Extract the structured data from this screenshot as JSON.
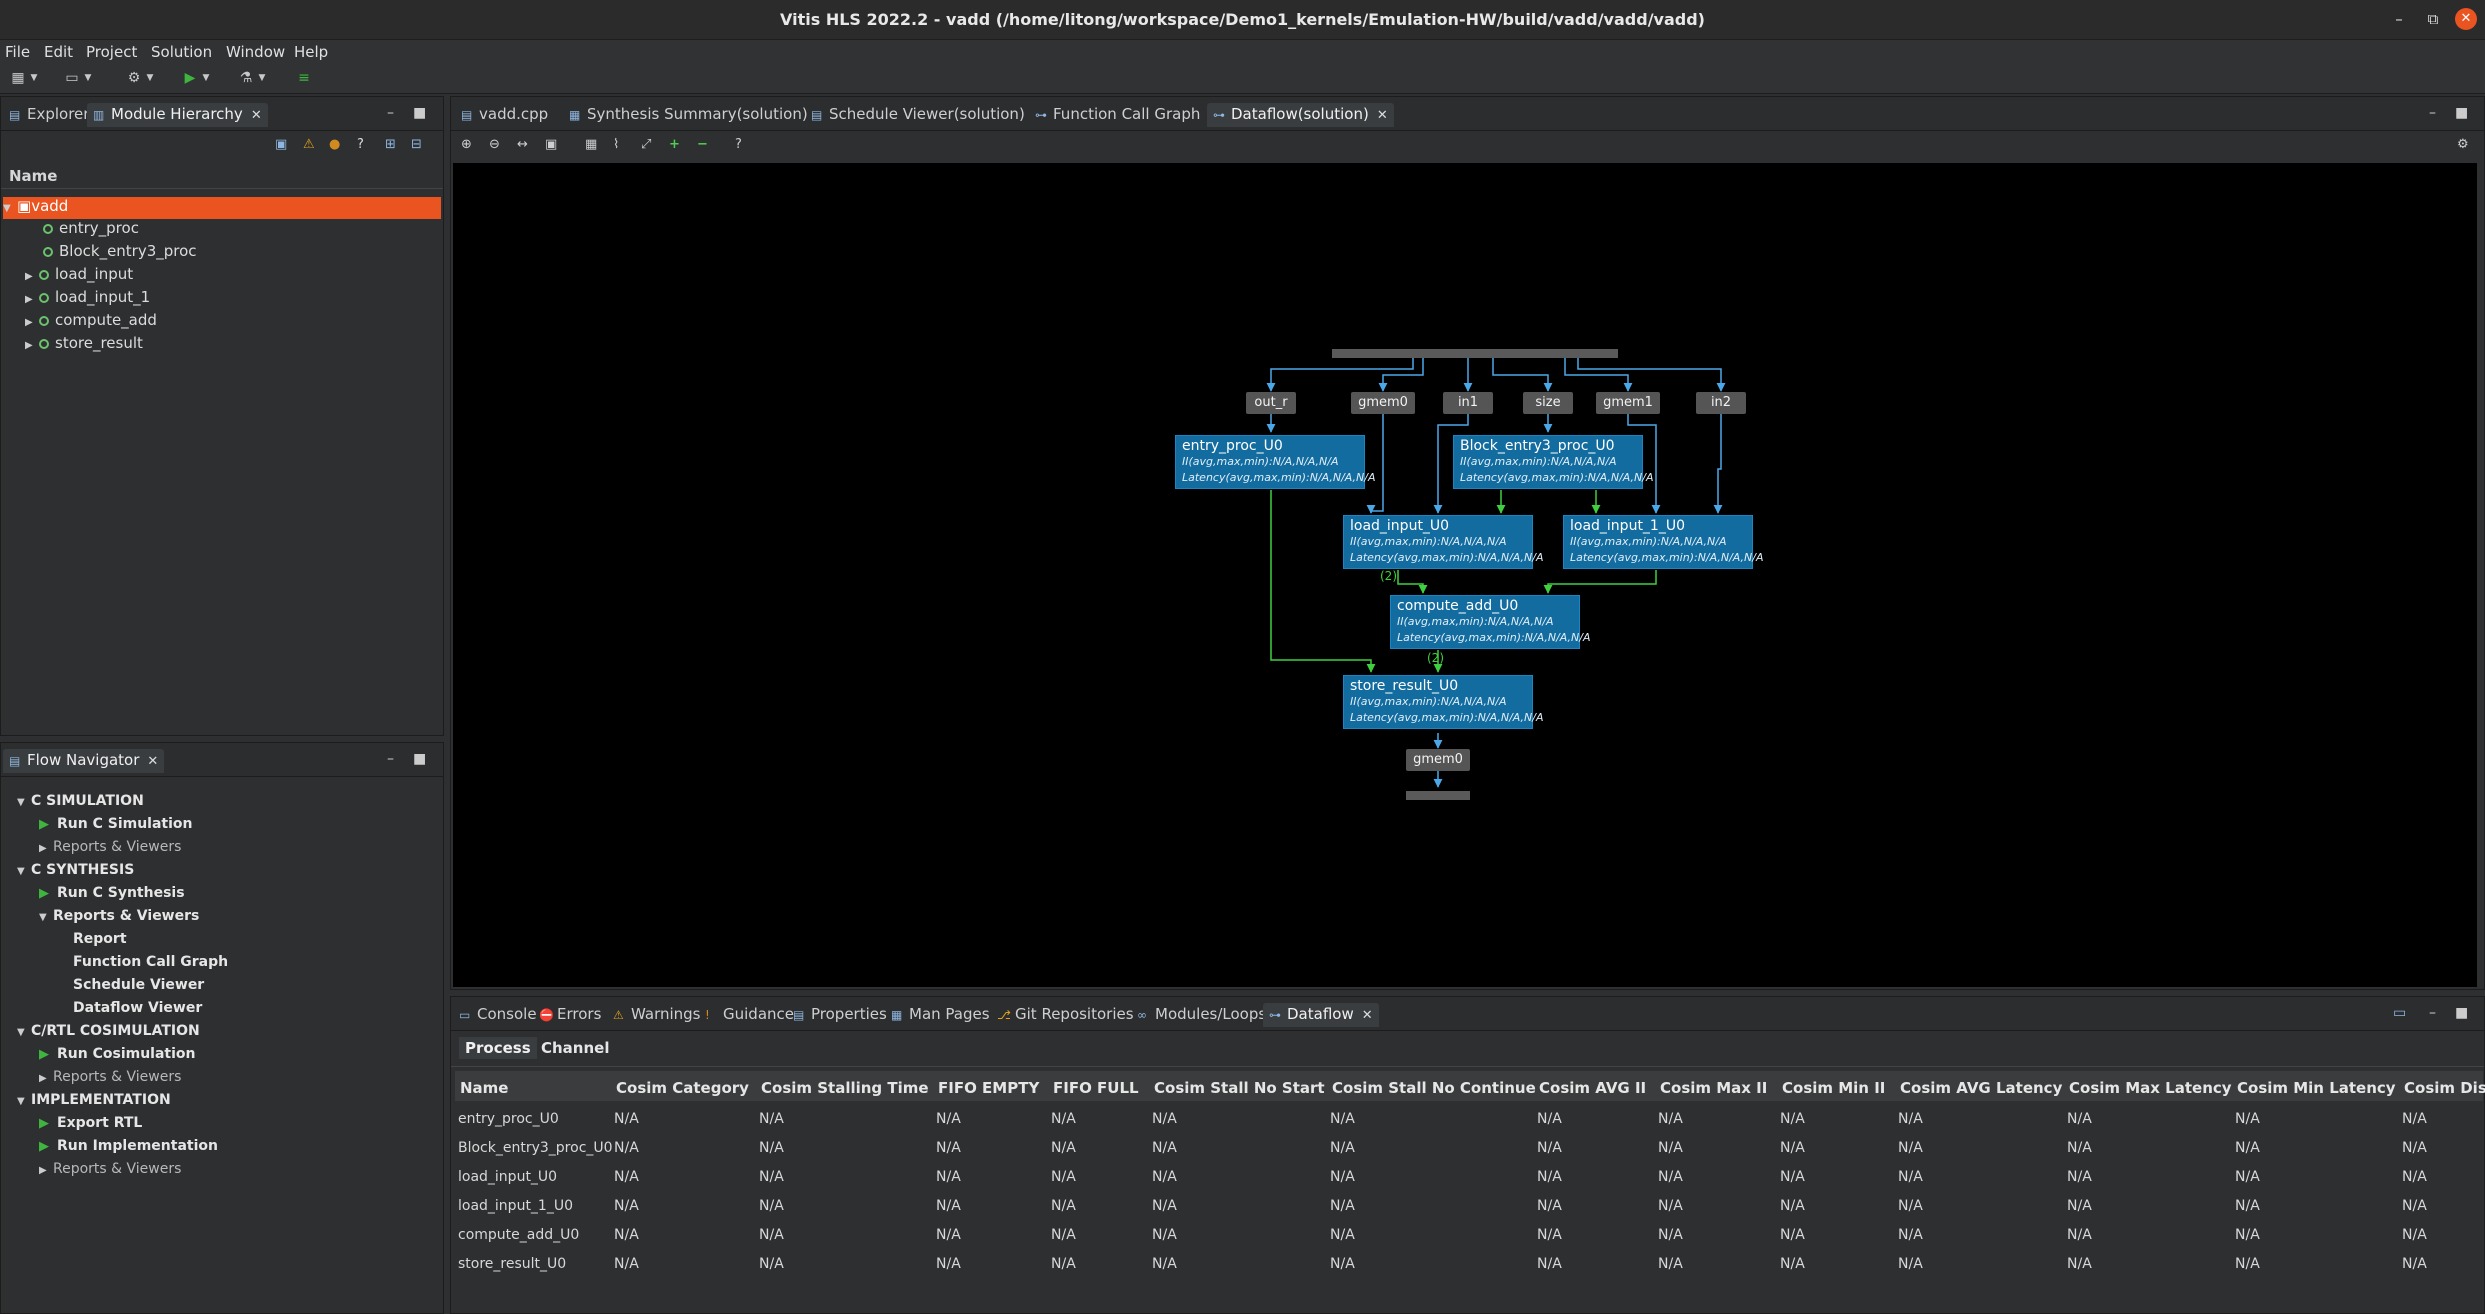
{
  "window": {
    "title": "Vitis HLS 2022.2 - vadd (/home/litong/workspace/Demo1_kernels/Emulation-HW/build/vadd/vadd/vadd)",
    "min": "–",
    "max": "⧉",
    "close": "✕"
  },
  "menu": [
    "File",
    "Edit",
    "Project",
    "Solution",
    "Window",
    "Help"
  ],
  "left_top": {
    "tabs": [
      {
        "label": "Explorer"
      },
      {
        "label": "Module Hierarchy",
        "close": "✕"
      }
    ],
    "column": "Name",
    "tree": [
      {
        "label": "vadd",
        "expanded": true,
        "selected": true
      },
      {
        "label": "entry_proc"
      },
      {
        "label": "Block_entry3_proc"
      },
      {
        "label": "load_input",
        "expandable": true
      },
      {
        "label": "load_input_1",
        "expandable": true
      },
      {
        "label": "compute_add",
        "expandable": true
      },
      {
        "label": "store_result",
        "expandable": true
      }
    ]
  },
  "flow_nav": {
    "tab": "Flow Navigator",
    "close": "✕",
    "sections": [
      {
        "title": "C SIMULATION",
        "run": "Run C Simulation",
        "reports": "Reports & Viewers"
      },
      {
        "title": "C SYNTHESIS",
        "run": "Run C Synthesis",
        "reports": "Reports & Viewers",
        "subitems": [
          "Report",
          "Function Call Graph",
          "Schedule Viewer",
          "Dataflow Viewer"
        ]
      },
      {
        "title": "C/RTL COSIMULATION",
        "run": "Run Cosimulation",
        "reports": "Reports & Viewers"
      },
      {
        "title": "IMPLEMENTATION",
        "run": "Export RTL",
        "run2": "Run Implementation",
        "reports": "Reports & Viewers"
      }
    ]
  },
  "editor": {
    "tabs": [
      {
        "label": "vadd.cpp"
      },
      {
        "label": "Synthesis Summary(solution)"
      },
      {
        "label": "Schedule Viewer(solution)"
      },
      {
        "label": "Function Call Graph"
      },
      {
        "label": "Dataflow(solution)",
        "active": true,
        "close": "✕"
      }
    ]
  },
  "dataflow": {
    "ports_top": [
      "out_r",
      "gmem0",
      "in1",
      "size",
      "gmem1",
      "in2"
    ],
    "port_bottom": "gmem0",
    "channel_label": "(2)",
    "nodes": [
      {
        "name": "entry_proc_U0",
        "ii": "II(avg,max,min):N/A,N/A,N/A",
        "lat": "Latency(avg,max,min):N/A,N/A,N/A"
      },
      {
        "name": "Block_entry3_proc_U0",
        "ii": "II(avg,max,min):N/A,N/A,N/A",
        "lat": "Latency(avg,max,min):N/A,N/A,N/A"
      },
      {
        "name": "load_input_U0",
        "ii": "II(avg,max,min):N/A,N/A,N/A",
        "lat": "Latency(avg,max,min):N/A,N/A,N/A"
      },
      {
        "name": "load_input_1_U0",
        "ii": "II(avg,max,min):N/A,N/A,N/A",
        "lat": "Latency(avg,max,min):N/A,N/A,N/A"
      },
      {
        "name": "compute_add_U0",
        "ii": "II(avg,max,min):N/A,N/A,N/A",
        "lat": "Latency(avg,max,min):N/A,N/A,N/A"
      },
      {
        "name": "store_result_U0",
        "ii": "II(avg,max,min):N/A,N/A,N/A",
        "lat": "Latency(avg,max,min):N/A,N/A,N/A"
      }
    ]
  },
  "bottom": {
    "tabs": [
      {
        "label": "Console"
      },
      {
        "label": "Errors"
      },
      {
        "label": "Warnings"
      },
      {
        "label": "Guidance"
      },
      {
        "label": "Properties"
      },
      {
        "label": "Man Pages"
      },
      {
        "label": "Git Repositories"
      },
      {
        "label": "Modules/Loops"
      },
      {
        "label": "Dataflow",
        "active": true,
        "close": "✕"
      }
    ],
    "subtabs": [
      "Process",
      "Channel"
    ],
    "columns": [
      "Name",
      "Cosim Category",
      "Cosim Stalling Time",
      "FIFO EMPTY",
      "FIFO FULL",
      "Cosim Stall No Start",
      "Cosim Stall No Continue",
      "Cosim AVG II",
      "Cosim Max II",
      "Cosim Min II",
      "Cosim AVG Latency",
      "Cosim Max Latency",
      "Cosim Min Latency",
      "Cosim Dis"
    ],
    "rows": [
      [
        "entry_proc_U0",
        "N/A",
        "N/A",
        "N/A",
        "N/A",
        "N/A",
        "N/A",
        "N/A",
        "N/A",
        "N/A",
        "N/A",
        "N/A",
        "N/A",
        "N/A"
      ],
      [
        "Block_entry3_proc_U0",
        "N/A",
        "N/A",
        "N/A",
        "N/A",
        "N/A",
        "N/A",
        "N/A",
        "N/A",
        "N/A",
        "N/A",
        "N/A",
        "N/A",
        "N/A"
      ],
      [
        "load_input_U0",
        "N/A",
        "N/A",
        "N/A",
        "N/A",
        "N/A",
        "N/A",
        "N/A",
        "N/A",
        "N/A",
        "N/A",
        "N/A",
        "N/A",
        "N/A"
      ],
      [
        "load_input_1_U0",
        "N/A",
        "N/A",
        "N/A",
        "N/A",
        "N/A",
        "N/A",
        "N/A",
        "N/A",
        "N/A",
        "N/A",
        "N/A",
        "N/A",
        "N/A"
      ],
      [
        "compute_add_U0",
        "N/A",
        "N/A",
        "N/A",
        "N/A",
        "N/A",
        "N/A",
        "N/A",
        "N/A",
        "N/A",
        "N/A",
        "N/A",
        "N/A",
        "N/A"
      ],
      [
        "store_result_U0",
        "N/A",
        "N/A",
        "N/A",
        "N/A",
        "N/A",
        "N/A",
        "N/A",
        "N/A",
        "N/A",
        "N/A",
        "N/A",
        "N/A",
        "N/A"
      ]
    ]
  },
  "colors": {
    "accent": "#e95420",
    "node": "#136c9f",
    "edge_blue": "#4aa8e8",
    "edge_green": "#3fcf3f"
  }
}
